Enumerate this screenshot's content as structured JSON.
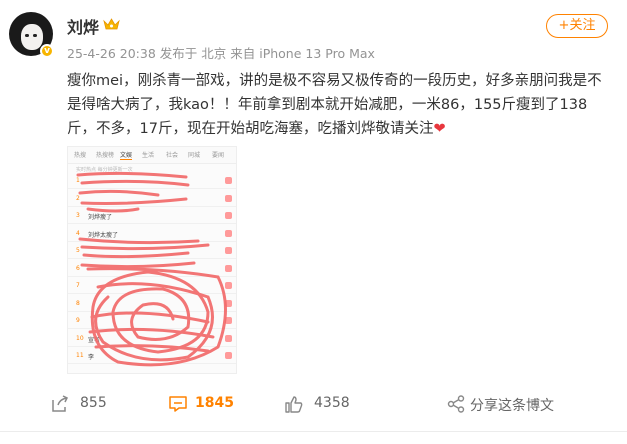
{
  "post": {
    "author": "刘烨",
    "time": "25-4-26 20:38",
    "location": "发布于 北京",
    "source": "来自 iPhone 13 Pro Max",
    "follow_label": "+关注",
    "text": "瘦你mei，刚杀青一部戏，讲的是极不容易又极传奇的一段历史，好多亲朋问我是不是得啥大病了，我kao！！年前拿到剧本就开始减肥，一米86，155斤瘦到了138斤，不多，17斤，现在开始胡吃海塞，吃播刘烨敬请关注",
    "heart": "❤",
    "verified_badge": "v"
  },
  "thumbnail": {
    "tabs": [
      "热搜",
      "热搜榜",
      "文娱",
      "生活",
      "社会",
      "同城",
      "要闻"
    ],
    "active_tab": 2,
    "subtitle": "实时热点 每分钟更新一次",
    "rows": [
      {
        "num": "1",
        "text": ""
      },
      {
        "num": "2",
        "text": ""
      },
      {
        "num": "3",
        "text": "刘烨瘦了"
      },
      {
        "num": "4",
        "text": "刘烨太瘦了"
      },
      {
        "num": "5",
        "text": ""
      },
      {
        "num": "6",
        "text": ""
      },
      {
        "num": "7",
        "text": ""
      },
      {
        "num": "8",
        "text": ""
      },
      {
        "num": "9",
        "text": ""
      },
      {
        "num": "10",
        "text": "宣名"
      },
      {
        "num": "11",
        "text": "李"
      }
    ],
    "scribble_color": "#f26a6a"
  },
  "actions": {
    "share_count": "855",
    "comment_count": "1845",
    "like_count": "4358",
    "share_label": "分享这条博文"
  },
  "colors": {
    "accent": "#ff8200",
    "text": "#333333",
    "meta": "#939393",
    "heart": "#e8373e"
  },
  "icons": [
    "verified-badge-icon",
    "crown-icon",
    "forward-icon",
    "comment-icon",
    "like-icon",
    "share-icon"
  ]
}
